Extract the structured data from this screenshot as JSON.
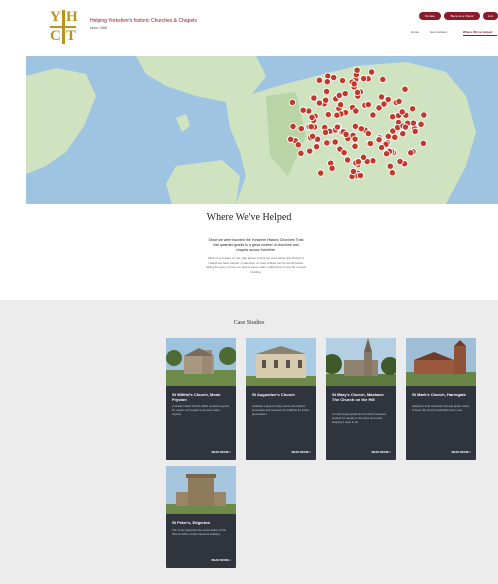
{
  "header": {
    "logo_letters": [
      "Y",
      "H",
      "C",
      "T"
    ],
    "tagline": "Helping Yorkshire's historic Churches & Chapels",
    "since": "since 1988",
    "pills": [
      {
        "label": "Donate",
        "color": "#8b1a2b"
      },
      {
        "label": "Become a Friend",
        "color": "#8b1a2b"
      },
      {
        "label": "Join",
        "color": "#8b1a2b"
      }
    ],
    "nav": [
      {
        "label": "Home"
      },
      {
        "label": "Get involved"
      },
      {
        "label": "Where We've Helped",
        "active": true
      }
    ]
  },
  "map": {
    "marker_color": "#c0392b",
    "sea_color": "#9fc4e2",
    "land_color": "#cfe3c0"
  },
  "intro": {
    "title": "Where We've Helped",
    "bold": "Since we were founded the Yorkshire Historic Churches Trust has awarded grants to a great number of churches and chapels across Yorkshire.",
    "text": "Click on a marker on the map above to find out more about the church or chapel we have helped. A selection of case studies can be found below, telling the story of how our grants have made a difference to the life of each building."
  },
  "case_studies": {
    "title": "Case Studies",
    "read_more": "READ MORE >",
    "cards": [
      {
        "title": "St Wilfrid's Church, Monk Fryston",
        "desc": "A Grade I listed church which received a grant for urgent roof repairs to prevent water ingress."
      },
      {
        "title": "St Augustine's Church",
        "desc": "Awarded a grant to help restore the historic stonework and preserve the building for future generations."
      },
      {
        "title": "St Mary's Church, Masham: The Church on the Hill",
        "desc": "A much-loved parish church which received support for repairs to the spire and tower, keeping it open to all."
      },
      {
        "title": "St Mark's Church, Harrogate",
        "desc": "Helped to fund essential roof and gutter works to keep this church watertight and in use."
      },
      {
        "title": "St Peter's, Edgerton",
        "desc": "The Trust supported the conservation of the historic fabric of this important building."
      }
    ]
  }
}
